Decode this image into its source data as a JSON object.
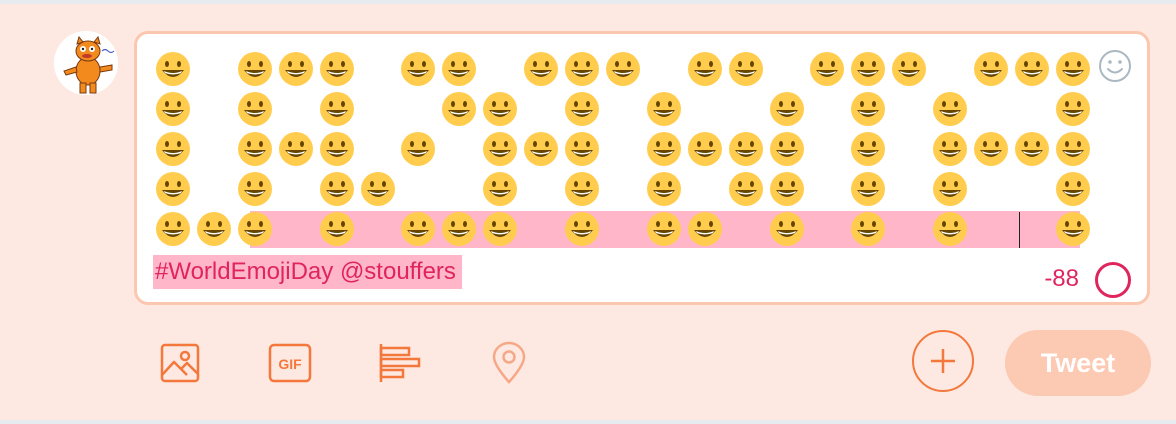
{
  "composer": {
    "tweet_text": "#WorldEmojiDay @stouffers",
    "char_counter": "-88",
    "emoji_glyph": "smiling-face-with-open-mouth",
    "emoji_rows": [
      [
        1,
        0,
        1,
        1,
        1,
        0,
        1,
        1,
        0,
        1,
        1,
        1,
        0,
        1,
        1,
        0,
        1,
        1,
        1,
        0,
        1,
        1,
        1
      ],
      [
        1,
        0,
        1,
        0,
        1,
        0,
        0,
        1,
        1,
        0,
        1,
        0,
        1,
        0,
        0,
        1,
        0,
        1,
        0,
        1,
        0,
        0,
        1
      ],
      [
        1,
        0,
        1,
        1,
        1,
        0,
        1,
        0,
        1,
        1,
        1,
        0,
        1,
        1,
        1,
        1,
        0,
        1,
        0,
        1,
        1,
        1,
        1
      ],
      [
        1,
        0,
        1,
        0,
        1,
        1,
        0,
        0,
        1,
        0,
        1,
        0,
        1,
        0,
        1,
        1,
        0,
        1,
        0,
        1,
        0,
        0,
        1
      ],
      [
        1,
        1,
        1,
        0,
        1,
        0,
        1,
        1,
        1,
        0,
        1,
        0,
        1,
        1,
        0,
        1,
        0,
        1,
        0,
        1,
        0,
        0,
        1
      ]
    ],
    "emoji_picker_icon": "smiley-outline-icon",
    "progress_icon": "character-count-ring-icon"
  },
  "avatar": {
    "icon": "cartoon-cat-avatar"
  },
  "toolbar": {
    "media_icon": "image-icon",
    "gif_label": "GIF",
    "poll_icon": "poll-icon",
    "location_icon": "location-pin-icon",
    "add_icon": "plus-icon",
    "tweet_label": "Tweet"
  },
  "colors": {
    "background": "#fde9e1",
    "accent": "#f4783b",
    "highlight": "#ffb6c8",
    "error_text": "#e0245e",
    "tweet_button_disabled": "#fcc9b2",
    "emoji_yellow": "#ffcc4d"
  }
}
